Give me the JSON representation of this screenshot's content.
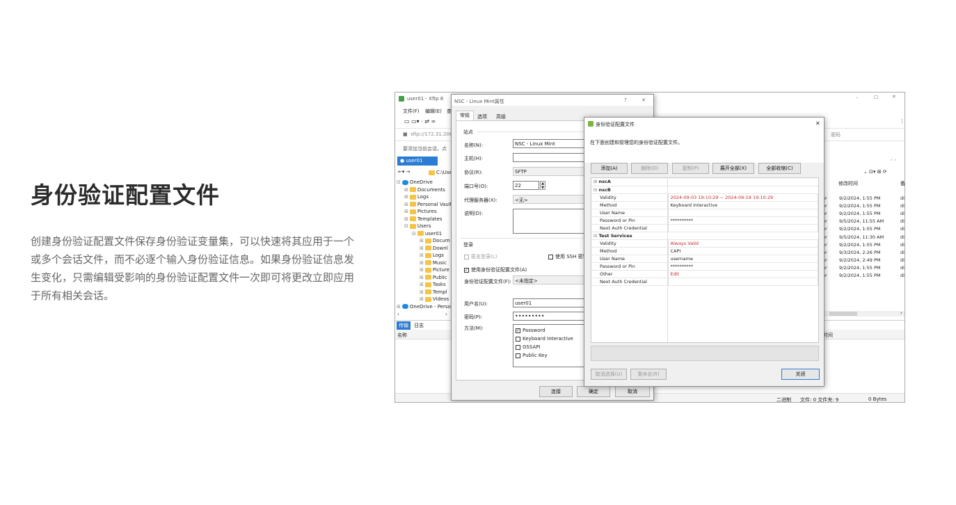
{
  "promo": {
    "title": "身份验证配置文件",
    "description": "创建身份验证配置文件保存身份验证变量集，可以快速将其应用于一个或多个会话文件，而不必逐个输入身份验证信息。如果身份验证信息发生变化，只需编辑受影响的身份验证配置文件一次即可将更改立即应用于所有相关会话。"
  },
  "xftp": {
    "window_title": "user01 - Xftp 8",
    "menu_file": "文件(F)",
    "menu_edit": "编辑(E)",
    "menu_more": "查",
    "address": "sftp://172.31.206.8",
    "session_hint": "要添加当前会话，点",
    "tab": "user01",
    "path": "C:\\Use",
    "tree": [
      {
        "label": "OneDrive",
        "kind": "cloud"
      },
      {
        "label": "Documents"
      },
      {
        "label": "Logs"
      },
      {
        "label": "Personal Vault"
      },
      {
        "label": "Pictures"
      },
      {
        "label": "Templates"
      },
      {
        "label": "Users"
      },
      {
        "label": "user01"
      },
      {
        "label": "Docum"
      },
      {
        "label": "Downl"
      },
      {
        "label": "Logs"
      },
      {
        "label": "Music"
      },
      {
        "label": "Picture"
      },
      {
        "label": "Public"
      },
      {
        "label": "Tasks"
      },
      {
        "label": "Templ"
      },
      {
        "label": "Videos"
      },
      {
        "label": "OneDrive - Persor",
        "kind": "cloud"
      }
    ],
    "transfer_tab": "传输",
    "log_tab": "日志",
    "name_col": "名称",
    "password_col": "密码",
    "modified_col": "修改时间",
    "time_col": "时间",
    "right_rows": [
      {
        "a": "er",
        "date": "9/2/2024, 1:55 PM",
        "x": "di"
      },
      {
        "a": "er",
        "date": "9/2/2024, 1:55 PM",
        "x": "di"
      },
      {
        "a": "er",
        "date": "9/2/2024, 1:55 PM",
        "x": "di"
      },
      {
        "a": "er",
        "date": "9/5/2024, 11:55 AM",
        "x": "di"
      },
      {
        "a": "er",
        "date": "9/2/2024, 1:55 PM",
        "x": "di"
      },
      {
        "a": "er",
        "date": "9/5/2024, 11:30 AM",
        "x": "di"
      },
      {
        "a": "er",
        "date": "9/2/2024, 1:55 PM",
        "x": "di"
      },
      {
        "a": "er",
        "date": "9/3/2024, 2:26 PM",
        "x": "di"
      },
      {
        "a": "er",
        "date": "9/2/2024, 2:49 PM",
        "x": "di"
      },
      {
        "a": "er",
        "date": "9/2/2024, 1:55 PM",
        "x": "di"
      },
      {
        "a": "er",
        "date": "9/2/2024, 1:55 PM",
        "x": "di"
      }
    ],
    "status_binary": "二进制",
    "status_files": "文件: 0 文件夹: 9",
    "status_size": "0 Bytes"
  },
  "nsc": {
    "title": "NSC - Linux Mint属性",
    "help": "?",
    "close": "✕",
    "tabs": [
      "常规",
      "选项",
      "高级"
    ],
    "group_site": "站点",
    "name_label": "名称(N):",
    "name_value": "NSC - Linux Mint",
    "host_label": "主机(H):",
    "protocol_label": "协议(R):",
    "protocol_value": "SFTP",
    "port_label": "端口号(O):",
    "port_value": "22",
    "proxy_label": "代理服务器(X):",
    "proxy_value": "<无>",
    "desc_label": "说明(D):",
    "group_login": "登录",
    "anon_label": "匿名登录(L)",
    "ssh_label": "使用 SSH 密钥",
    "use_profile_label": "使用身份验证配置文件(A)",
    "profile_label": "身份验证配置文件(F):",
    "profile_value": "<未指定>",
    "user_label": "用户名(U):",
    "user_value": "user01",
    "pass_label": "密码(P):",
    "pass_value": "•••••••••",
    "method_label": "方法(M):",
    "methods": [
      "Password",
      "Keyboard Interactive",
      "GSSAPI",
      "Public Key"
    ],
    "connect": "连接",
    "ok": "确定",
    "cancel": "取消"
  },
  "auth": {
    "title": "身份验证配置文件",
    "close": "✕",
    "desc": "在下面创建和管理您的身份验证配置文件。",
    "add": "添加(A)",
    "delete": "删除(D)",
    "copy": "复制(P)",
    "expand": "展开全部(X)",
    "collapse": "全部收缩(C)",
    "profiles": [
      {
        "name": "nscA",
        "expanded": false,
        "rows": []
      },
      {
        "name": "nscB",
        "expanded": true,
        "rows": [
          {
            "k": "Validity",
            "v": "2024-09-03 19:10:29 ~ 2024-09-19 19:10:29",
            "red": true
          },
          {
            "k": "Method",
            "v": "Keyboard Interactive"
          },
          {
            "k": "User Name",
            "v": ""
          },
          {
            "k": "Password or Pin",
            "v": "**********"
          },
          {
            "k": "Next Auth Credential",
            "v": ""
          }
        ]
      },
      {
        "name": "Test Services",
        "expanded": true,
        "rows": [
          {
            "k": "Validity",
            "v": "Always Valid",
            "red": true
          },
          {
            "k": "Method",
            "v": "CAPI"
          },
          {
            "k": "User Name",
            "v": "username"
          },
          {
            "k": "Password or Pin",
            "v": "**********"
          },
          {
            "k": "Other",
            "v": "Edit",
            "red": true
          },
          {
            "k": "Next Auth Credential",
            "v": ""
          }
        ]
      }
    ],
    "unselect": "取消选择(U)",
    "rename": "重命名(R)",
    "close_btn": "关闭"
  },
  "colors": {
    "accent": "#2b7cd3",
    "xftp_green": "#43a047",
    "red_text": "#c62828",
    "folder": "#f6c342"
  }
}
